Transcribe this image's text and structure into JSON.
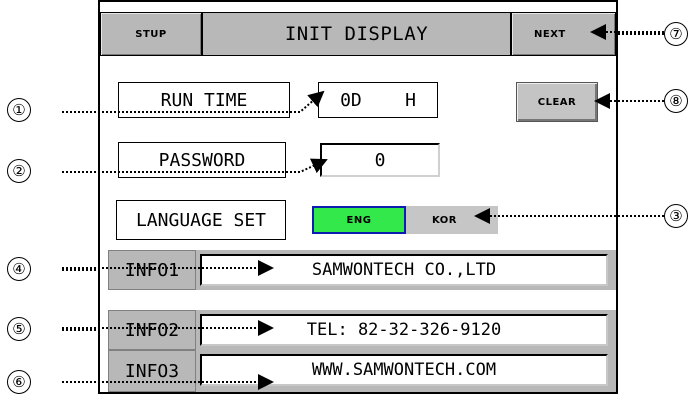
{
  "header": {
    "stup_label": "STUP",
    "title": "INIT DISPLAY",
    "next_label": "NEXT"
  },
  "fields": {
    "run_time_label": "RUN TIME",
    "run_time_value": "0D    H",
    "password_label": "PASSWORD",
    "password_value": "0",
    "language_label": "LANGUAGE SET",
    "eng_label": "ENG",
    "kor_label": "KOR",
    "clear_label": "CLEAR"
  },
  "info": [
    {
      "label": "INFO1",
      "value": "SAMWONTECH CO.,LTD"
    },
    {
      "label": "INFO2",
      "value": "TEL: 82-32-326-9120"
    },
    {
      "label": "INFO3",
      "value": "WWW.SAMWONTECH.COM"
    }
  ],
  "callouts": [
    "①",
    "②",
    "③",
    "④",
    "⑤",
    "⑥",
    "⑦",
    "⑧"
  ],
  "colors": {
    "eng_active": "#33e84a",
    "panel_gray": "#b8b8b8"
  }
}
